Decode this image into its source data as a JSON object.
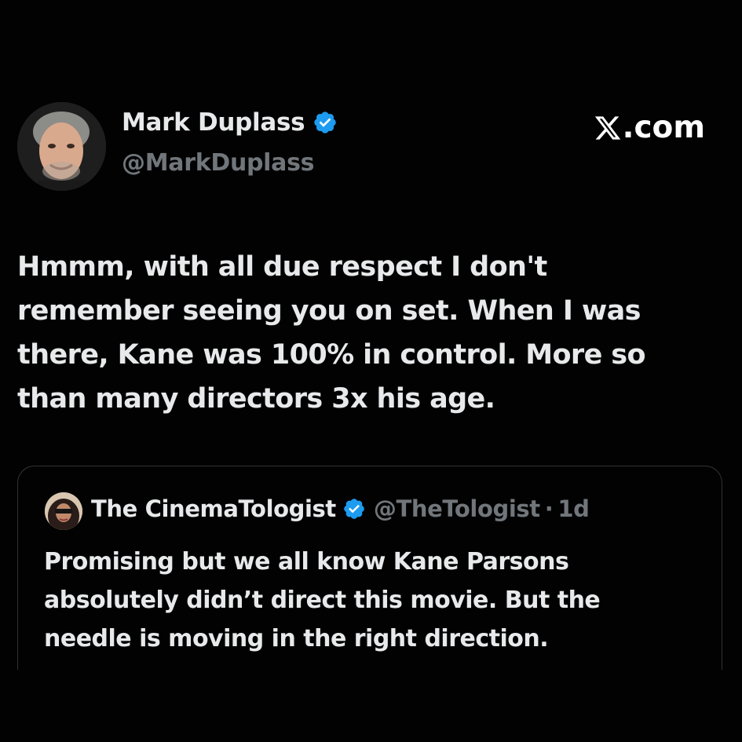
{
  "author": {
    "display_name": "Mark Duplass",
    "handle": "@MarkDuplass",
    "avatar_icon": "user-avatar-photo",
    "verified_icon": "verified-badge-icon"
  },
  "brand": {
    "logo_icon": "x-logo-icon",
    "label": ".com"
  },
  "tweet": {
    "lines": [
      "Hmmm, with all due respect I don't",
      "remember seeing you on set. When I was",
      "there, Kane was 100% in control. More so",
      "than many directors 3x his age."
    ]
  },
  "quoted_tweet": {
    "display_name": "The CinemaTologist",
    "handle": "@TheTologist",
    "separator": "·",
    "time": "1d",
    "avatar_icon": "user-avatar-photo",
    "verified_icon": "verified-badge-icon",
    "lines": [
      "Promising but we all know Kane Parsons",
      "absolutely didn’t direct this movie. But the",
      "needle is moving in the right direction."
    ]
  },
  "colors": {
    "background": "#020202",
    "text_primary": "#e7e9ea",
    "text_secondary": "#71767b",
    "verified_blue": "#1d9bf0",
    "border": "#2f3336"
  }
}
